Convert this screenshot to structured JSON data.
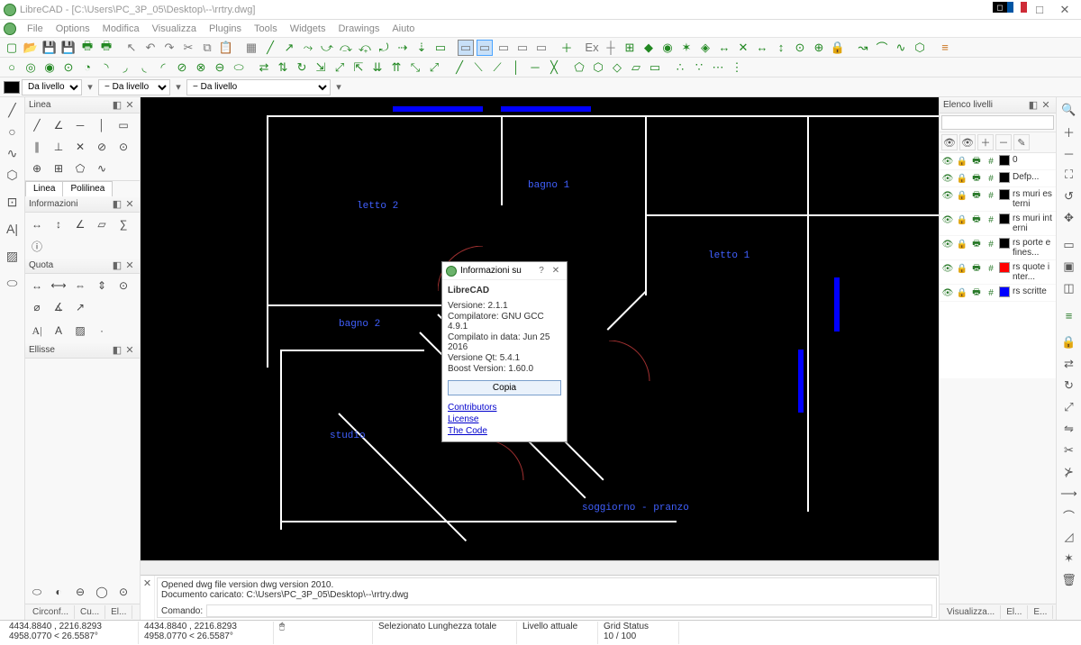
{
  "window": {
    "title": "LibreCAD - [C:\\Users\\PC_3P_05\\Desktop\\--\\rrtry.dwg]"
  },
  "menu": [
    "File",
    "Options",
    "Modifica",
    "Visualizza",
    "Plugins",
    "Tools",
    "Widgets",
    "Drawings",
    "Aiuto"
  ],
  "prop": {
    "layer1": "Da livello",
    "layer2": "− Da livello",
    "layer3": "− Da livello"
  },
  "panels": {
    "linea": "Linea",
    "informazioni": "Informazioni",
    "quota": "Quota",
    "ellisse": "Ellisse"
  },
  "tabs": {
    "linea": "Linea",
    "polilinea": "Polilinea"
  },
  "rooms": {
    "letto2": "letto 2",
    "bagno1": "bagno 1",
    "letto1": "letto 1",
    "bagno2": "bagno 2",
    "studio": "studio",
    "soggiorno": "soggiorno - pranzo"
  },
  "layers_panel": {
    "title": "Elenco livelli",
    "filter_placeholder": ""
  },
  "layers": [
    {
      "color": "#000000",
      "name": "0"
    },
    {
      "color": "#000000",
      "name": "Defp..."
    },
    {
      "color": "#000000",
      "name": "rs muri esterni"
    },
    {
      "color": "#000000",
      "name": "rs muri interni"
    },
    {
      "color": "#000000",
      "name": "rs porte e fines..."
    },
    {
      "color": "#ff0000",
      "name": "rs quote inter..."
    },
    {
      "color": "#0000ff",
      "name": "rs scritte"
    }
  ],
  "command": {
    "log1": "Opened dwg file version dwg version 2010.",
    "log2": "Documento caricato: C:\\Users\\PC_3P_05\\Desktop\\--\\rrtry.dwg",
    "label": "Comando:"
  },
  "left_bottom_tabs": [
    "Circonf...",
    "Cu...",
    "El..."
  ],
  "right_bottom_tabs": [
    "Visualizza...",
    "El...",
    "E..."
  ],
  "status": {
    "coord1a": "4434.8840 , 2216.8293",
    "coord1b": "4958.0770 < 26.5587°",
    "coord2a": "4434.8840 , 2216.8293",
    "coord2b": "4958.0770 < 26.5587°",
    "sel": "Selezionato Lunghezza totale",
    "livello": "Livello attuale",
    "grid": "Grid Status",
    "gridval": "10 / 100"
  },
  "dialog": {
    "title": "Informazioni su",
    "app": "LibreCAD",
    "ver": "Versione: 2.1.1",
    "comp": "Compilatore: GNU GCC 4.9.1",
    "date": "Compilato in data: Jun 25 2016",
    "qt": "Versione Qt: 5.4.1",
    "boost": "Boost Version: 1.60.0",
    "copy": "Copia",
    "link1": "Contributors",
    "link2": "License",
    "link3": "The Code"
  }
}
